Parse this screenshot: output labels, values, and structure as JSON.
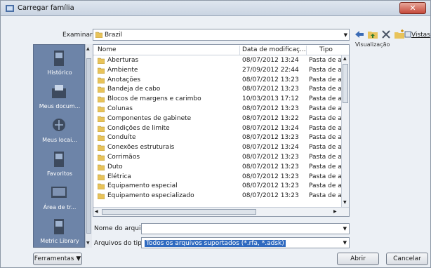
{
  "window": {
    "title": "Carregar família",
    "close_glyph": "✕"
  },
  "toolbar": {
    "look_in_label": "Examinar:",
    "look_in_value": "Brazil",
    "views_label": "Vistas",
    "preview_label": "Visualização",
    "icons": [
      "back-arrow-icon",
      "up-folder-icon",
      "delete-icon",
      "new-folder-icon",
      "views-icon"
    ]
  },
  "places": [
    {
      "label": "Histórico",
      "icon": "history-icon"
    },
    {
      "label": "Meus docum...",
      "icon": "my-documents-icon"
    },
    {
      "label": "Meus locai...",
      "icon": "my-network-icon"
    },
    {
      "label": "Favoritos",
      "icon": "favorites-icon"
    },
    {
      "label": "Área de tr...",
      "icon": "desktop-icon"
    },
    {
      "label": "Metric Library",
      "icon": "library-icon"
    }
  ],
  "file_list": {
    "columns": [
      "Nome",
      "Data de modificaç...",
      "Tipo"
    ],
    "rows": [
      {
        "name": "Aberturas",
        "date": "08/07/2012 13:24",
        "type": "Pasta de ar"
      },
      {
        "name": "Ambiente",
        "date": "27/09/2012 22:44",
        "type": "Pasta de ar"
      },
      {
        "name": "Anotações",
        "date": "08/07/2012 13:23",
        "type": "Pasta de ar"
      },
      {
        "name": "Bandeja de cabo",
        "date": "08/07/2012 13:23",
        "type": "Pasta de ar"
      },
      {
        "name": "Blocos de margens e carimbo",
        "date": "10/03/2013 17:12",
        "type": "Pasta de ar"
      },
      {
        "name": "Colunas",
        "date": "08/07/2012 13:23",
        "type": "Pasta de ar"
      },
      {
        "name": "Componentes de gabinete",
        "date": "08/07/2012 13:22",
        "type": "Pasta de ar"
      },
      {
        "name": "Condições de limite",
        "date": "08/07/2012 13:24",
        "type": "Pasta de ar"
      },
      {
        "name": "Conduíte",
        "date": "08/07/2012 13:23",
        "type": "Pasta de ar"
      },
      {
        "name": "Conexões estruturais",
        "date": "08/07/2012 13:24",
        "type": "Pasta de ar"
      },
      {
        "name": "Corrimãos",
        "date": "08/07/2012 13:23",
        "type": "Pasta de ar"
      },
      {
        "name": "Duto",
        "date": "08/07/2012 13:23",
        "type": "Pasta de ar"
      },
      {
        "name": "Elétrica",
        "date": "08/07/2012 13:23",
        "type": "Pasta de ar"
      },
      {
        "name": "Equipamento especial",
        "date": "08/07/2012 13:23",
        "type": "Pasta de ar"
      },
      {
        "name": "Equipamento especializado",
        "date": "08/07/2012 13:23",
        "type": "Pasta de ar"
      }
    ]
  },
  "file_name": {
    "label": "Nome do arquivo:",
    "value": ""
  },
  "file_type": {
    "label": "Arquivos do tipo:",
    "value": "Todos os arquivos suportados (*.rfa, *.adsk)"
  },
  "buttons": {
    "tools": "Ferramentas",
    "open": "Abrir",
    "cancel": "Cancelar"
  },
  "colors": {
    "places_bg": "#6d84a8",
    "selection": "#2f6ac0",
    "close": "#c5483a"
  }
}
